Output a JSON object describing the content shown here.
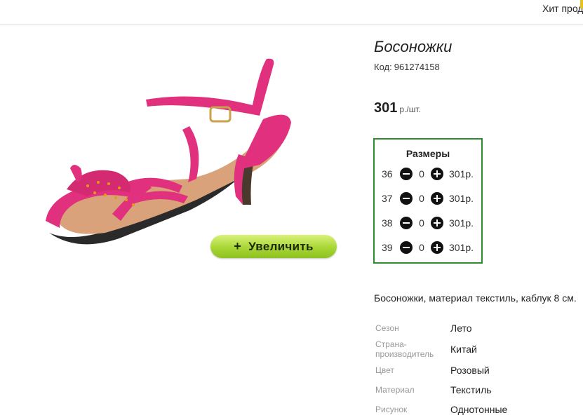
{
  "header": {
    "top_link": "Хит прод"
  },
  "product": {
    "title": "Босоножки",
    "code_label": "Код:",
    "code": "961274158",
    "price": "301",
    "price_unit": "р./шт.",
    "image_icon": "pink-sandal-image",
    "zoom_button": "Увеличить",
    "description": "Босоножки, материал текстиль, каблук 8 см."
  },
  "sizes": {
    "title": "Размеры",
    "rows": [
      {
        "size": "36",
        "qty": "0",
        "price": "301р."
      },
      {
        "size": "37",
        "qty": "0",
        "price": "301р."
      },
      {
        "size": "38",
        "qty": "0",
        "price": "301р."
      },
      {
        "size": "39",
        "qty": "0",
        "price": "301р."
      }
    ]
  },
  "properties": [
    {
      "label": "Сезон",
      "value": "Лето"
    },
    {
      "label_line1": "Страна-",
      "label_line2": "производитель",
      "value": "Китай"
    },
    {
      "label": "Цвет",
      "value": "Розовый"
    },
    {
      "label": "Материал",
      "value": "Текстиль"
    },
    {
      "label": "Рисунок",
      "value": "Однотонные"
    }
  ],
  "colors": {
    "accent_green": "#8fc21f",
    "border_green": "#2e8b2e",
    "shoe_pink": "#e0307e"
  }
}
